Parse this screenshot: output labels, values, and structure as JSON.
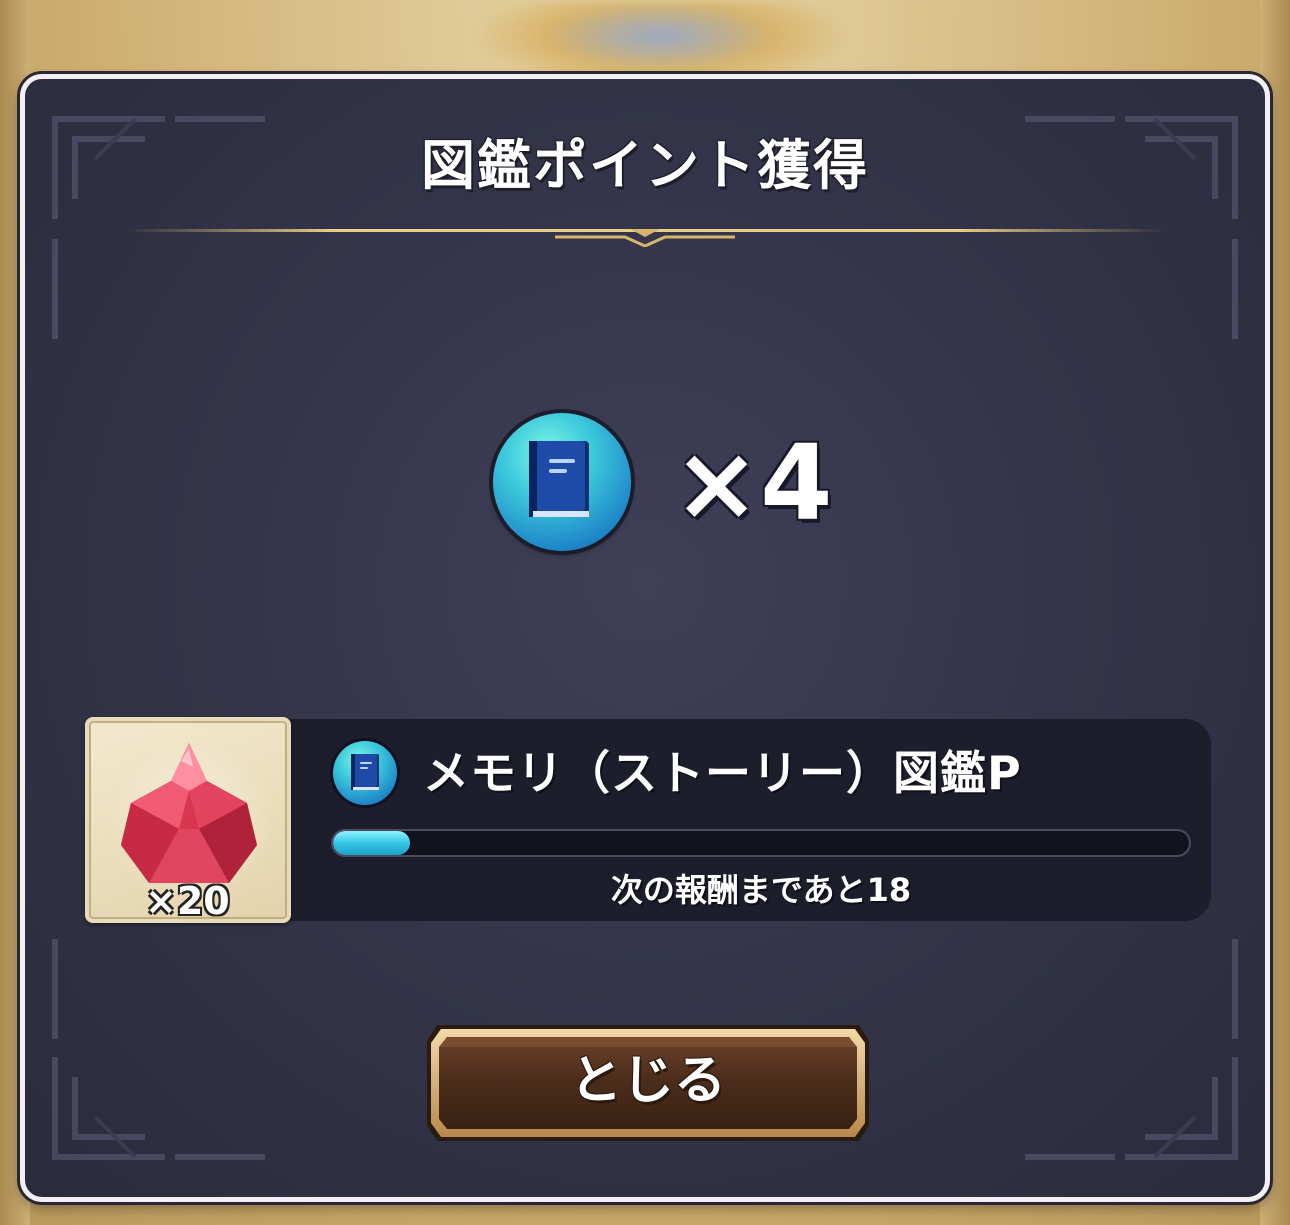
{
  "dialog": {
    "title": "図鑑ポイント獲得"
  },
  "points_gained": {
    "icon": "book-icon",
    "multiplier_text": "×4",
    "value": 4
  },
  "reward": {
    "item_icon": "red-crystal-icon",
    "item_quantity_text": "×20",
    "category_icon": "book-icon",
    "label": "メモリ（ストーリー）図鑑P",
    "progress_fraction": 0.09,
    "remaining_text": "次の報酬まであと18"
  },
  "buttons": {
    "close_label": "とじる"
  },
  "colors": {
    "dialog_bg": "#34354a",
    "panel_bg": "#1d1e2c",
    "progress_fill": "#35c6e6",
    "gold_accent": "#d8b56a",
    "button_bg": "#4a2c1a"
  }
}
